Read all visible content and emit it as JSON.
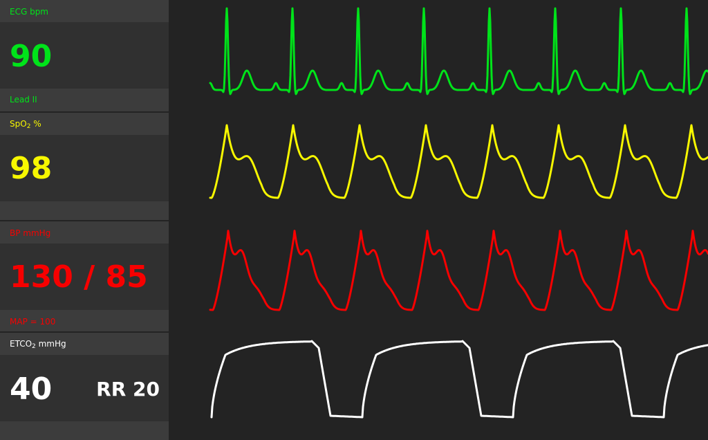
{
  "ecg": {
    "label": "ECG bpm",
    "value": "90",
    "lead": "Lead II",
    "color": "#00e31a"
  },
  "spo2": {
    "label_prefix": "SpO",
    "label_sub": "2",
    "label_suffix": " %",
    "value": "98",
    "color": "#f7f700"
  },
  "bp": {
    "label": "BP mmHg",
    "value": "130 / 85",
    "map": "MAP = 100",
    "color": "#f70000"
  },
  "etco2": {
    "label_prefix": "ETCO",
    "label_sub": "2",
    "label_suffix": " mmHg",
    "value": "40",
    "rr": "RR 20",
    "color": "#ffffff"
  },
  "waveforms": [
    {
      "name": "ecg-waveform",
      "color": "#00e31a"
    },
    {
      "name": "spo2-pleth-waveform",
      "color": "#f7f700"
    },
    {
      "name": "arterial-bp-waveform",
      "color": "#f70000"
    },
    {
      "name": "capnography-waveform",
      "color": "#ffffff"
    }
  ]
}
